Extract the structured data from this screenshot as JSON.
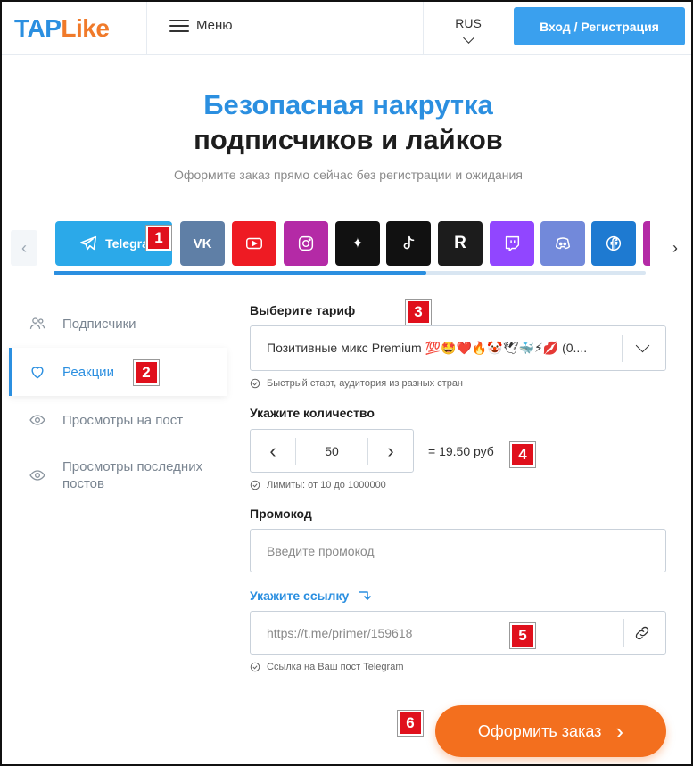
{
  "header": {
    "logo_tap": "TAP",
    "logo_like": "Like",
    "menu_label": "Меню",
    "lang": "RUS",
    "login_label": "Вход / Регистрация"
  },
  "hero": {
    "title_line1": "Безопасная накрутка",
    "title_line2": "подписчиков и лайков",
    "subtitle": "Оформите заказ прямо сейчас без регистрации и ожидания"
  },
  "platforms": {
    "active_label": "Telegra",
    "items": [
      "telegram",
      "vk",
      "youtube",
      "instagram",
      "threads",
      "tiktok",
      "rutube",
      "twitch",
      "discord",
      "facebook"
    ],
    "colors": {
      "telegram": "#2ba9e9",
      "vk": "#5f7fa6",
      "youtube": "#ee1b23",
      "instagram": "#b42aa6",
      "threads": "#111111",
      "tiktok": "#111111",
      "rutube": "#1c1c1c",
      "twitch": "#9146ff",
      "discord": "#7289da",
      "facebook": "#1e7ad1"
    },
    "scroll_progress": 0.63
  },
  "sidebar": {
    "items": [
      {
        "label": "Подписчики",
        "icon": "users-icon"
      },
      {
        "label": "Реакции",
        "icon": "heart-icon"
      },
      {
        "label": "Просмотры на пост",
        "icon": "eye-icon"
      },
      {
        "label": "Просмотры последних постов",
        "icon": "eye-icon"
      }
    ]
  },
  "form": {
    "tariff_label": "Выберите тариф",
    "tariff_value": "Позитивные микс Premium 💯🤩❤️🔥🤡🕊🐳⚡💋 (0....",
    "tariff_hint": "Быстрый старт, аудитория из разных стран",
    "qty_label": "Укажите количество",
    "qty_value": "50",
    "qty_price": "= 19.50 руб",
    "qty_hint": "Лимиты: от 10 до 1000000",
    "promo_label": "Промокод",
    "promo_placeholder": "Введите промокод",
    "link_label": "Укажите ссылку",
    "link_placeholder": "https://t.me/primer/159618",
    "link_hint": "Ссылка на Ваш пост Telegram",
    "submit_label": "Оформить заказ"
  },
  "markers": [
    "1",
    "2",
    "3",
    "4",
    "5",
    "6"
  ],
  "colors": {
    "brand_blue": "#2b8fe0",
    "brand_orange": "#f07a2a",
    "button_orange": "#f36f1e",
    "marker_red": "#e0101c"
  }
}
